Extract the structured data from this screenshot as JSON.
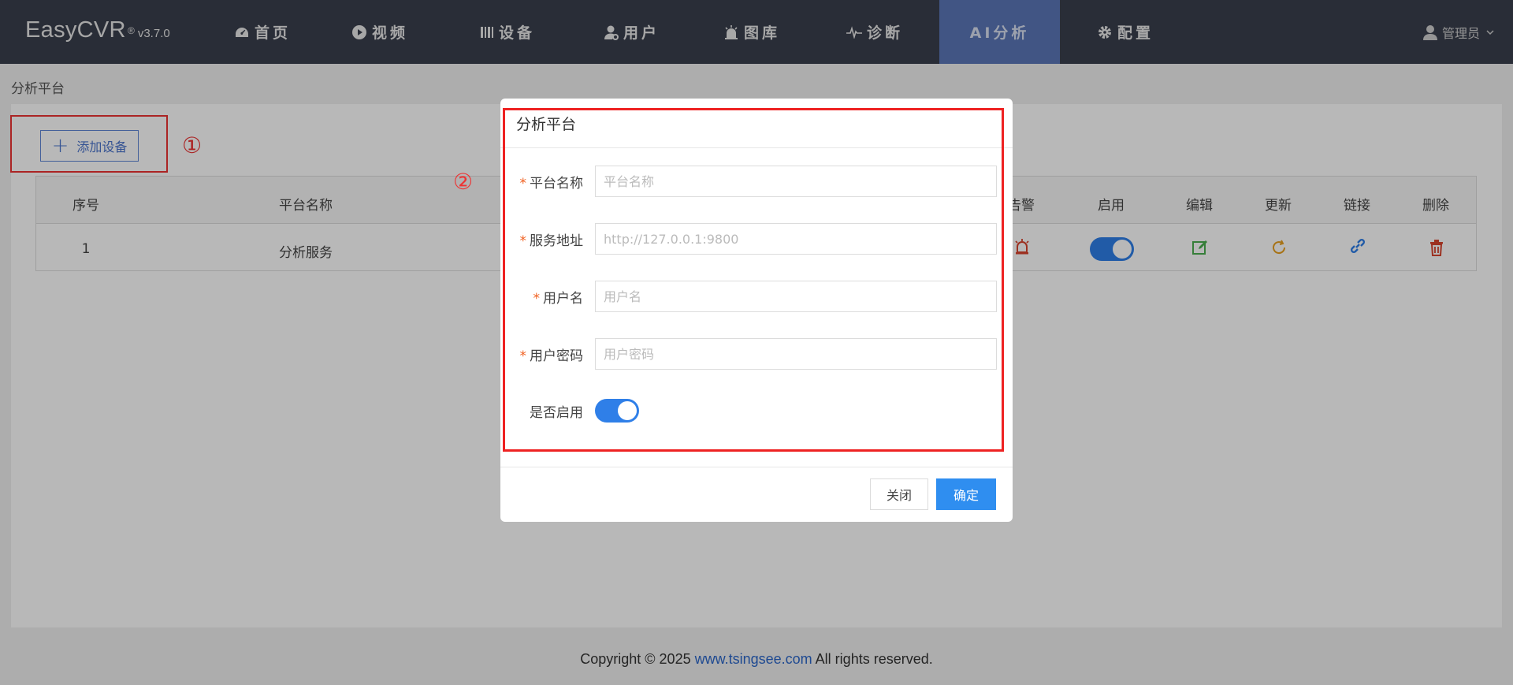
{
  "app": {
    "brand": "EasyCVR",
    "version_mark": "®",
    "version": "v3.7.0"
  },
  "nav": {
    "items": [
      {
        "label": "首页",
        "icon": "dashboard-icon"
      },
      {
        "label": "视频",
        "icon": "play-icon"
      },
      {
        "label": "设备",
        "icon": "device-icon"
      },
      {
        "label": "用户",
        "icon": "user-gear-icon"
      },
      {
        "label": "图库",
        "icon": "alarm-icon"
      },
      {
        "label": "诊断",
        "icon": "pulse-icon"
      },
      {
        "label": "AI分析",
        "icon": ""
      },
      {
        "label": "配置",
        "icon": "gear-icon"
      }
    ],
    "active": "AI分析",
    "user": "管理员"
  },
  "breadcrumb": "分析平台",
  "toolbar": {
    "add_label": "添加设备"
  },
  "annotations": {
    "step1": "①",
    "step2": "②"
  },
  "table": {
    "headers": [
      "序号",
      "平台名称",
      "告警",
      "启用",
      "编辑",
      "更新",
      "链接",
      "删除"
    ],
    "rows": [
      {
        "index": "1",
        "name": "分析服务",
        "enabled": true
      }
    ]
  },
  "dialog": {
    "title": "分析平台",
    "fields": [
      {
        "label": "平台名称",
        "placeholder": "平台名称",
        "required": true
      },
      {
        "label": "服务地址",
        "placeholder": "http://127.0.0.1:9800",
        "required": true
      },
      {
        "label": "用户名",
        "placeholder": "用户名",
        "required": true
      },
      {
        "label": "用户密码",
        "placeholder": "用户密码",
        "required": true
      }
    ],
    "enable_label": "是否启用",
    "enabled": true,
    "required_mark": "*",
    "close_label": "关闭",
    "ok_label": "确定"
  },
  "footer": {
    "prefix": "Copyright © 2025 ",
    "link": "www.tsingsee.com",
    "suffix": " All rights reserved."
  },
  "colors": {
    "nav_bg": "#3a3f4d",
    "nav_active": "#5b77b8",
    "accent": "#2f8ef0",
    "annotation": "#e33333"
  }
}
